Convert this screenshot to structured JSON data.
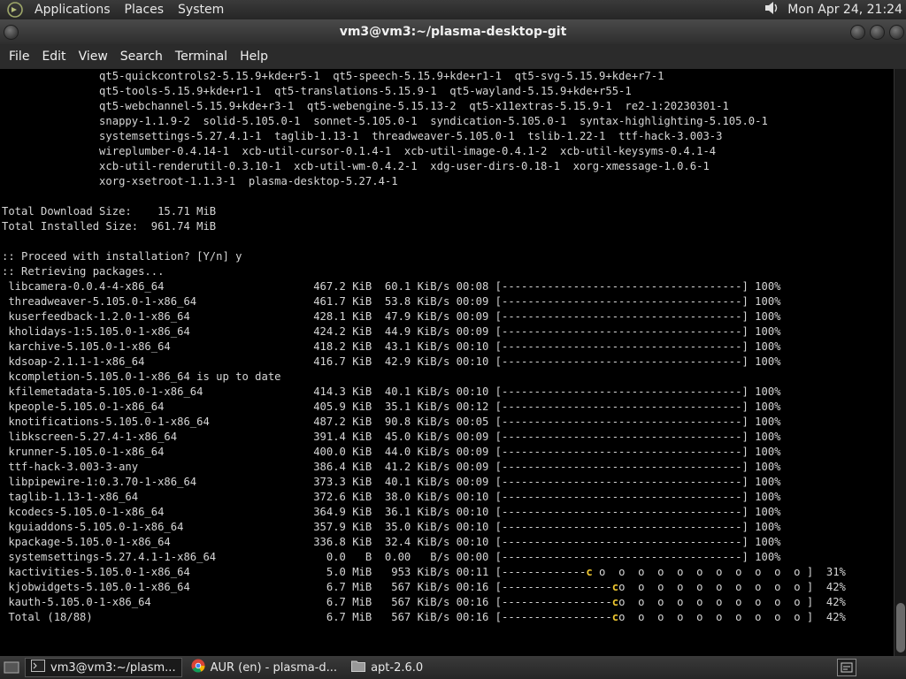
{
  "top_panel": {
    "menus": [
      "Applications",
      "Places",
      "System"
    ],
    "clock": "Mon Apr 24, 21:24",
    "icons": [
      "gnome-logo-icon",
      "volume-icon"
    ]
  },
  "window": {
    "title": "vm3@vm3:~/plasma-desktop-git"
  },
  "menubar": {
    "items": [
      "File",
      "Edit",
      "View",
      "Search",
      "Terminal",
      "Help"
    ]
  },
  "terminal": {
    "lines": [
      "               qt5-quickcontrols2-5.15.9+kde+r5-1  qt5-speech-5.15.9+kde+r1-1  qt5-svg-5.15.9+kde+r7-1",
      "               qt5-tools-5.15.9+kde+r1-1  qt5-translations-5.15.9-1  qt5-wayland-5.15.9+kde+r55-1",
      "               qt5-webchannel-5.15.9+kde+r3-1  qt5-webengine-5.15.13-2  qt5-x11extras-5.15.9-1  re2-1:20230301-1",
      "               snappy-1.1.9-2  solid-5.105.0-1  sonnet-5.105.0-1  syndication-5.105.0-1  syntax-highlighting-5.105.0-1",
      "               systemsettings-5.27.4.1-1  taglib-1.13-1  threadweaver-5.105.0-1  tslib-1.22-1  ttf-hack-3.003-3",
      "               wireplumber-0.4.14-1  xcb-util-cursor-0.1.4-1  xcb-util-image-0.4.1-2  xcb-util-keysyms-0.4.1-4",
      "               xcb-util-renderutil-0.3.10-1  xcb-util-wm-0.4.2-1  xdg-user-dirs-0.18-1  xorg-xmessage-1.0.6-1",
      "               xorg-xsetroot-1.1.3-1  plasma-desktop-5.27.4-1",
      "",
      "Total Download Size:    15.71 MiB",
      "Total Installed Size:  961.74 MiB",
      "",
      ":: Proceed with installation? [Y/n] y",
      ":: Retrieving packages...",
      " libcamera-0.0.4-4-x86_64                       467.2 KiB  60.1 KiB/s 00:08 [-------------------------------------] 100%",
      " threadweaver-5.105.0-1-x86_64                  461.7 KiB  53.8 KiB/s 00:09 [-------------------------------------] 100%",
      " kuserfeedback-1.2.0-1-x86_64                   428.1 KiB  47.9 KiB/s 00:09 [-------------------------------------] 100%",
      " kholidays-1:5.105.0-1-x86_64                   424.2 KiB  44.9 KiB/s 00:09 [-------------------------------------] 100%",
      " karchive-5.105.0-1-x86_64                      418.2 KiB  43.1 KiB/s 00:10 [-------------------------------------] 100%",
      " kdsoap-2.1.1-1-x86_64                          416.7 KiB  42.9 KiB/s 00:10 [-------------------------------------] 100%",
      " kcompletion-5.105.0-1-x86_64 is up to date",
      " kfilemetadata-5.105.0-1-x86_64                 414.3 KiB  40.1 KiB/s 00:10 [-------------------------------------] 100%",
      " kpeople-5.105.0-1-x86_64                       405.9 KiB  35.1 KiB/s 00:12 [-------------------------------------] 100%",
      " knotifications-5.105.0-1-x86_64                487.2 KiB  90.8 KiB/s 00:05 [-------------------------------------] 100%",
      " libkscreen-5.27.4-1-x86_64                     391.4 KiB  45.0 KiB/s 00:09 [-------------------------------------] 100%",
      " krunner-5.105.0-1-x86_64                       400.0 KiB  44.0 KiB/s 00:09 [-------------------------------------] 100%",
      " ttf-hack-3.003-3-any                           386.4 KiB  41.2 KiB/s 00:09 [-------------------------------------] 100%",
      " libpipewire-1:0.3.70-1-x86_64                  373.3 KiB  40.1 KiB/s 00:09 [-------------------------------------] 100%",
      " taglib-1.13-1-x86_64                           372.6 KiB  38.0 KiB/s 00:10 [-------------------------------------] 100%",
      " kcodecs-5.105.0-1-x86_64                       364.9 KiB  36.1 KiB/s 00:10 [-------------------------------------] 100%",
      " kguiaddons-5.105.0-1-x86_64                    357.9 KiB  35.0 KiB/s 00:10 [-------------------------------------] 100%",
      " kpackage-5.105.0-1-x86_64                      336.8 KiB  32.4 KiB/s 00:10 [-------------------------------------] 100%",
      " systemsettings-5.27.4.1-1-x86_64                 0.0   B  0.00   B/s 00:00 [-------------------------------------] 100%"
    ],
    "progress_lines": [
      {
        "pre": " kactivities-5.105.0-1-x86_64                     5.0 MiB   953 KiB/s 00:11 [-------------",
        "pac": "c",
        "post": " o  o  o  o  o  o  o  o  o  o  o ]  31%"
      },
      {
        "pre": " kjobwidgets-5.105.0-1-x86_64                     6.7 MiB   567 KiB/s 00:16 [-----------------",
        "pac": "c",
        "post": "o  o  o  o  o  o  o  o  o  o ]  42%"
      },
      {
        "pre": " kauth-5.105.0-1-x86_64                           6.7 MiB   567 KiB/s 00:16 [-----------------",
        "pac": "c",
        "post": "o  o  o  o  o  o  o  o  o  o ]  42%"
      },
      {
        "pre": " Total (18/88)                                    6.7 MiB   567 KiB/s 00:16 [-----------------",
        "pac": "c",
        "post": "o  o  o  o  o  o  o  o  o  o ]  42%"
      }
    ]
  },
  "taskbar": {
    "tasks": [
      {
        "label": "vm3@vm3:~/plasm...",
        "icon": "terminal-icon",
        "active": true
      },
      {
        "label": "AUR (en) - plasma-d...",
        "icon": "chrome-icon",
        "active": false
      },
      {
        "label": "apt-2.6.0",
        "icon": "folder-icon",
        "active": false
      }
    ]
  }
}
